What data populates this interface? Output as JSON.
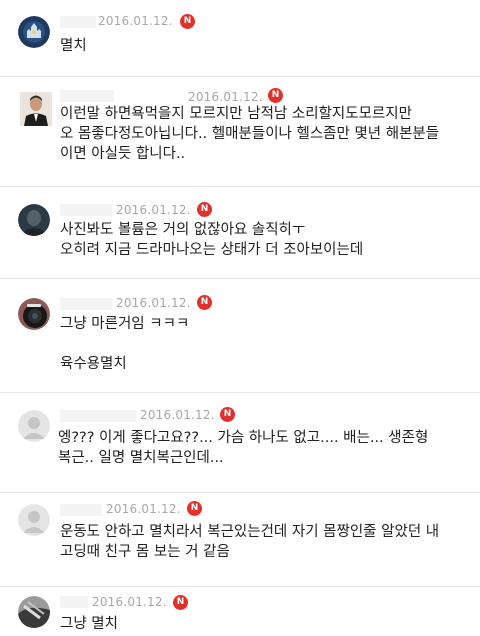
{
  "colors": {
    "badge": "#e0322b",
    "date": "#a8a8a8",
    "divider": "#e6e6e6"
  },
  "badge_label": "N",
  "comments": [
    {
      "avatar": "disney-castle-avatar",
      "date": "2016.01.12.",
      "text": "멸치"
    },
    {
      "avatar": "man-portrait-avatar",
      "date": "2016.01.12.",
      "text": "이런말 하면욕먹을지 모르지만 남적남 소리할지도모르지만\n오 몸좋다정도아닙니다.. 헬매분들이나 헬스좀만 몇년 해본분들\n이면 아실듯 합니다.."
    },
    {
      "avatar": "dark-figure-avatar",
      "date": "2016.01.12.",
      "text": "사진봐도 볼륨은 거의 없잖아요 솔직히ㅜ\n오히려 지금 드라마나오는 상태가 더 조아보이는데"
    },
    {
      "avatar": "camera-lens-avatar",
      "date": "2016.01.12.",
      "text": "그냥 마른거임 ㅋㅋㅋ\n\n육수용멸치"
    },
    {
      "avatar": "default-user-avatar",
      "date": "2016.01.12.",
      "text": "엥??? 이게 좋다고요??... 가슴 하나도 없고.... 배는... 생존형\n복근.. 일명 멸치복근인데..."
    },
    {
      "avatar": "default-user-avatar",
      "date": "2016.01.12.",
      "text": "운동도 안하고 멸치라서 복근있는건데 자기 몸짱인줄 알았던 내\n고딩때 친구 몸 보는 거 같음"
    },
    {
      "avatar": "bw-photo-avatar",
      "date": "2016.01.12.",
      "text": "그냥 멸치"
    }
  ]
}
